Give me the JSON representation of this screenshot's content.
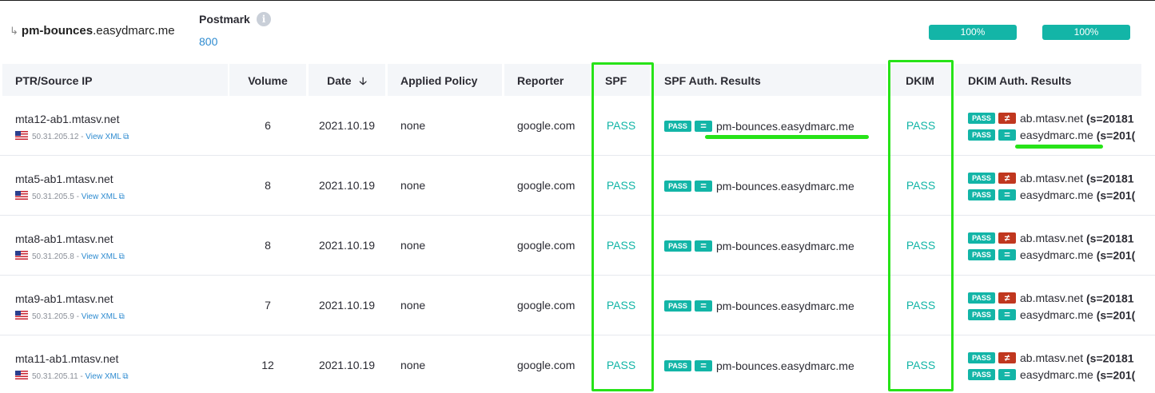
{
  "summary": {
    "domain_bold": "pm-bounces",
    "domain_rest": ".easydmarc.me",
    "postmark_label": "Postmark",
    "postmark_value": "800",
    "pct_spf": "100%",
    "pct_dkim": "100%"
  },
  "columns": {
    "ptr": "PTR/Source IP",
    "volume": "Volume",
    "date": "Date",
    "policy": "Applied Policy",
    "reporter": "Reporter",
    "spf": "SPF",
    "spf_auth": "SPF Auth. Results",
    "dkim": "DKIM",
    "dkim_auth": "DKIM Auth. Results"
  },
  "labels": {
    "pass_badge": "PASS",
    "eq_symbol": "=",
    "view_xml": "View XML",
    "separator": " - "
  },
  "rows": [
    {
      "ptr": "mta12-ab1.mtasv.net",
      "ip": "50.31.205.12",
      "volume": "6",
      "date": "2021.10.19",
      "policy": "none",
      "reporter": "google.com",
      "spf": "PASS",
      "spf_domain": "pm-bounces.easydmarc.me",
      "dkim": "PASS",
      "dkim1_domain": "ab.mtasv.net",
      "dkim1_sel": "(s=20181",
      "dkim2_domain": "easydmarc.me",
      "dkim2_sel": "(s=201("
    },
    {
      "ptr": "mta5-ab1.mtasv.net",
      "ip": "50.31.205.5",
      "volume": "8",
      "date": "2021.10.19",
      "policy": "none",
      "reporter": "google.com",
      "spf": "PASS",
      "spf_domain": "pm-bounces.easydmarc.me",
      "dkim": "PASS",
      "dkim1_domain": "ab.mtasv.net",
      "dkim1_sel": "(s=20181",
      "dkim2_domain": "easydmarc.me",
      "dkim2_sel": "(s=201("
    },
    {
      "ptr": "mta8-ab1.mtasv.net",
      "ip": "50.31.205.8",
      "volume": "8",
      "date": "2021.10.19",
      "policy": "none",
      "reporter": "google.com",
      "spf": "PASS",
      "spf_domain": "pm-bounces.easydmarc.me",
      "dkim": "PASS",
      "dkim1_domain": "ab.mtasv.net",
      "dkim1_sel": "(s=20181",
      "dkim2_domain": "easydmarc.me",
      "dkim2_sel": "(s=201("
    },
    {
      "ptr": "mta9-ab1.mtasv.net",
      "ip": "50.31.205.9",
      "volume": "7",
      "date": "2021.10.19",
      "policy": "none",
      "reporter": "google.com",
      "spf": "PASS",
      "spf_domain": "pm-bounces.easydmarc.me",
      "dkim": "PASS",
      "dkim1_domain": "ab.mtasv.net",
      "dkim1_sel": "(s=20181",
      "dkim2_domain": "easydmarc.me",
      "dkim2_sel": "(s=201("
    },
    {
      "ptr": "mta11-ab1.mtasv.net",
      "ip": "50.31.205.11",
      "volume": "12",
      "date": "2021.10.19",
      "policy": "none",
      "reporter": "google.com",
      "spf": "PASS",
      "spf_domain": "pm-bounces.easydmarc.me",
      "dkim": "PASS",
      "dkim1_domain": "ab.mtasv.net",
      "dkim1_sel": "(s=20181",
      "dkim2_domain": "easydmarc.me",
      "dkim2_sel": "(s=201("
    }
  ],
  "icons": {
    "subdomain": "corner-arrow-icon",
    "info": "info-icon",
    "sort": "arrow-down-icon",
    "flag": "us-flag-icon",
    "external": "external-link-icon",
    "not_equal": "not-equal-icon"
  },
  "colors": {
    "accent": "#13b5a7",
    "link": "#2e8bd0",
    "fail": "#c0371f",
    "highlight": "#27e318",
    "header_bg": "#f4f6f9"
  }
}
